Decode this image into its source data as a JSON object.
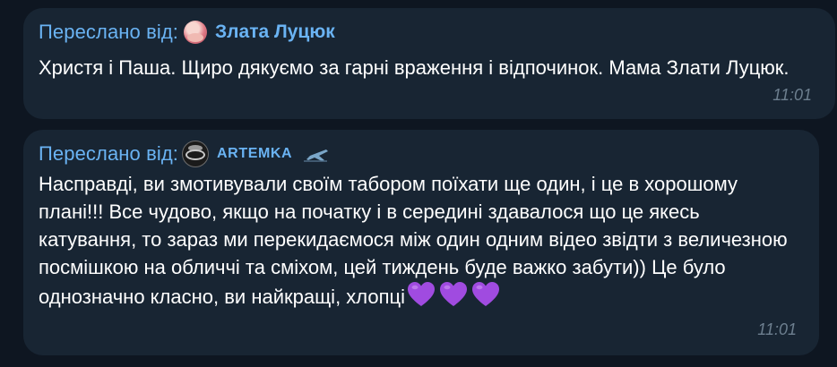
{
  "messages": [
    {
      "forwarded_prefix": "Переслано від:",
      "sender": "Злата Луцюк",
      "avatar_icon": "user-avatar-icon",
      "text": "Христя і Паша. Щиро дякуємо за гарні враження і відпочинок. Мама Злати Луцюк.",
      "time": "11:01"
    },
    {
      "forwarded_prefix": "Переслано від:",
      "sender": "ARTEMKA",
      "avatar_icon": "ring-avatar-icon",
      "sender_emoji_icon": "airplane-icon",
      "text": "Насправді, ви змотивували своїм табором поїхати ще один, і це в хорошому плані!!! Все чудово, якщо на початку і в середині здавалося що це якесь катування, то зараз ми перекидаємося між один одним відео звідти з величезною посмішкою на обличчі та сміхом, цей тиждень буде важко забути)) Це було однозначно класно, ви найкращі, хлопці",
      "trailing_emoji_icons": [
        "purple-heart-icon",
        "purple-heart-icon",
        "purple-heart-icon"
      ],
      "time": "11:01"
    }
  ],
  "colors": {
    "background": "#0e1621",
    "bubble": "#182533",
    "forward_accent": "#6ab3f3",
    "message_text": "#ffffff",
    "time_text": "#6d7f8f",
    "heart": "#a04be0"
  }
}
